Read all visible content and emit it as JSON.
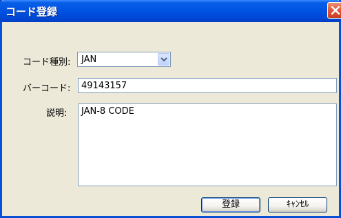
{
  "window": {
    "title": "コード登録"
  },
  "form": {
    "code_type_label": "コード種別:",
    "code_type_value": "JAN",
    "barcode_label": "バーコード:",
    "barcode_value": "49143157",
    "description_label": "説明:",
    "description_value": "JAN-8 CODE"
  },
  "buttons": {
    "register_label": "登録",
    "cancel_label": "ｷｬﾝｾﾙ"
  },
  "colors": {
    "titlebar": "#0054e3",
    "dialog_bg": "#ece9d8",
    "close_button": "#e2553a",
    "field_border": "#7f9db9"
  },
  "icons": {
    "close": "close-icon",
    "dropdown": "chevron-down-icon"
  }
}
